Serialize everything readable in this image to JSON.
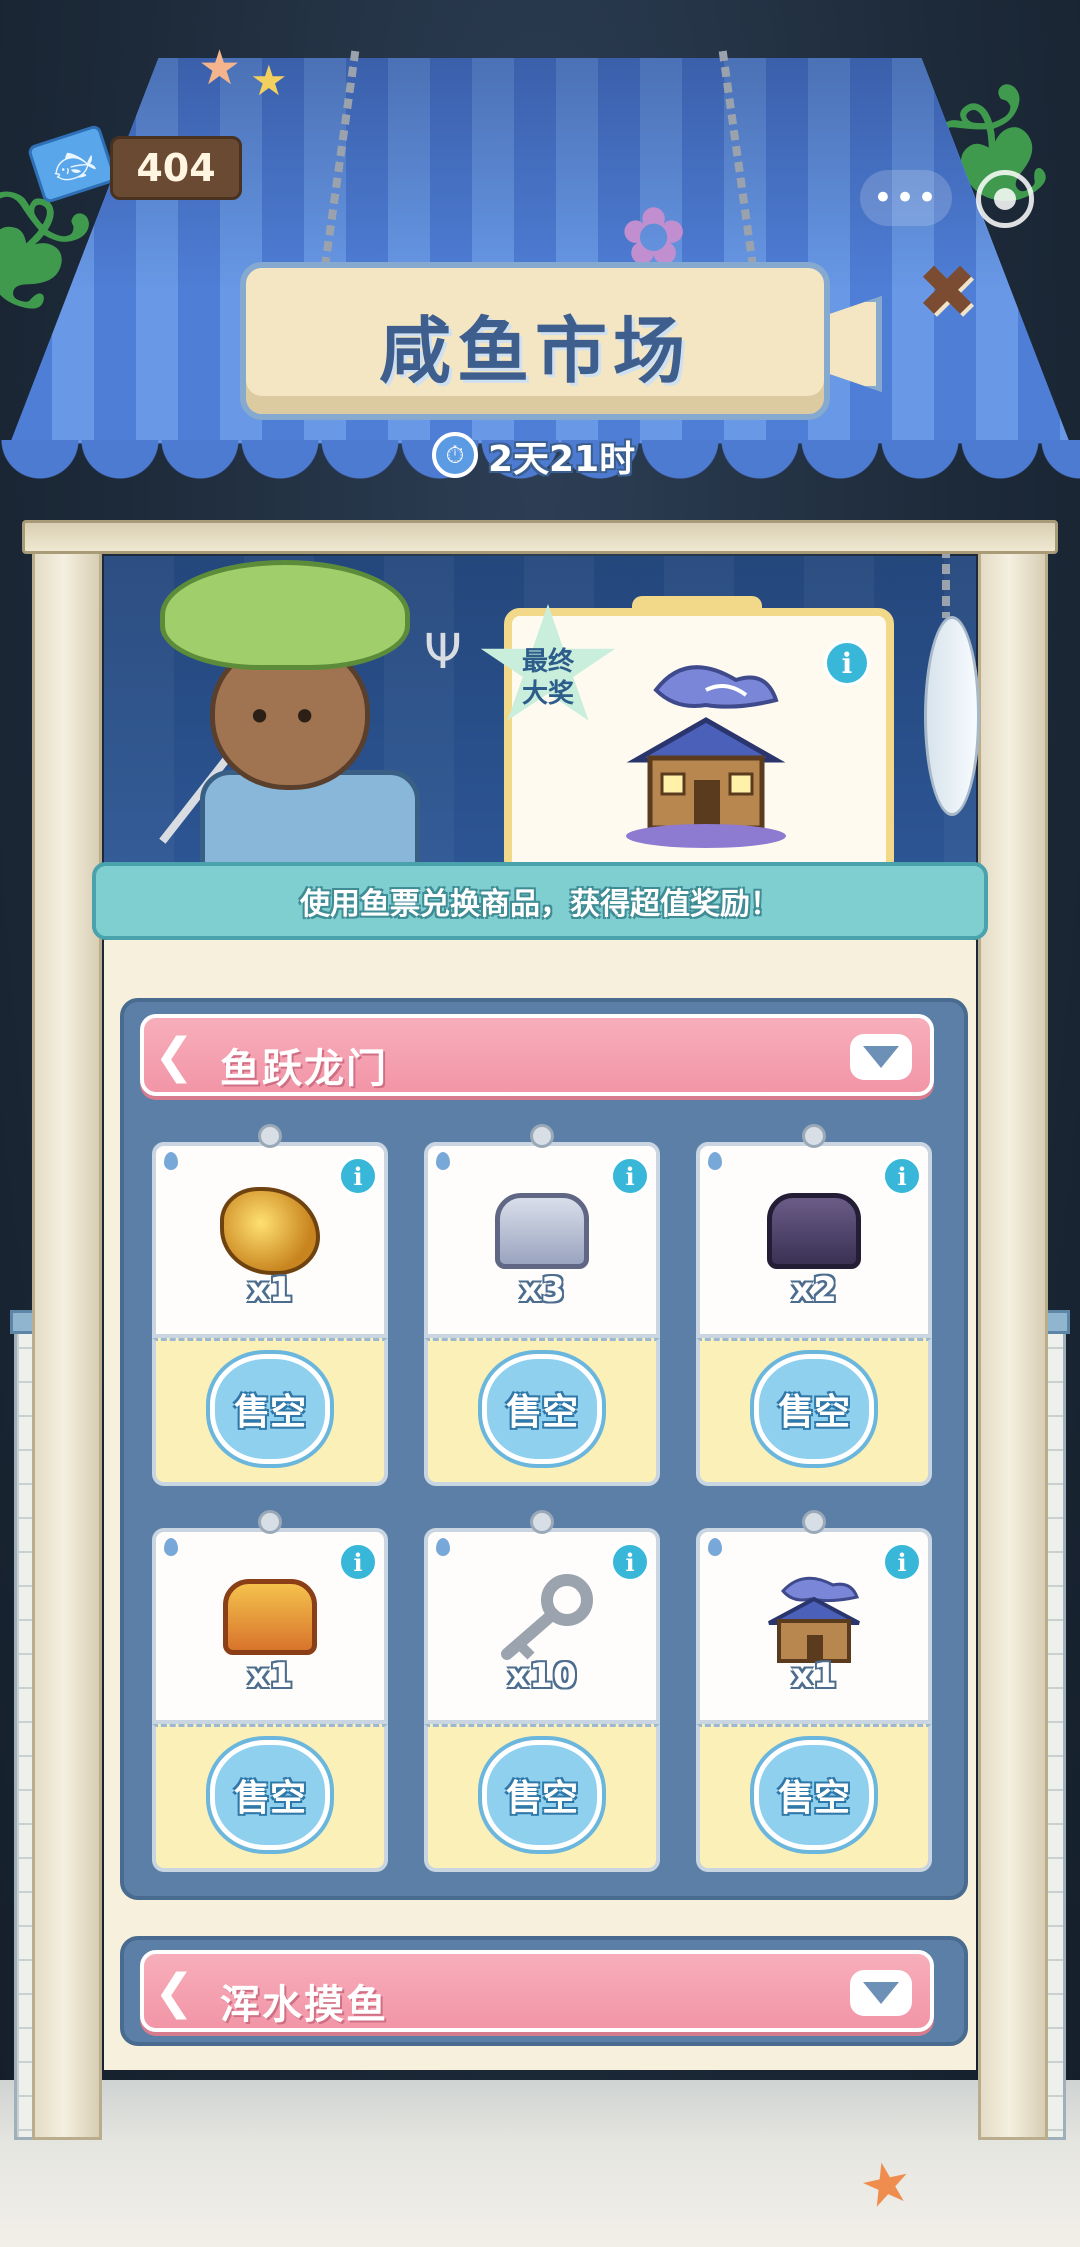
{
  "currency": {
    "icon": "fish-ticket-icon",
    "amount": "404"
  },
  "top_controls": {
    "more_label": "•••",
    "close_label": "✖"
  },
  "sign": {
    "title": "咸鱼市场",
    "timer_icon": "stopwatch-icon",
    "timer": "2天21时"
  },
  "hero": {
    "badge": "最终\n大奖",
    "badge_line1": "最终",
    "badge_line2": "大奖",
    "info_label": "i",
    "ribbon_text": "使用鱼票兑换商品，获得超值奖励！"
  },
  "sections": [
    {
      "title": "鱼跃龙门",
      "items": [
        {
          "icon": "golden-dragon-icon",
          "qty": "x1",
          "status": "售空",
          "info": "i"
        },
        {
          "icon": "silver-chest-icon",
          "qty": "x3",
          "status": "售空",
          "info": "i"
        },
        {
          "icon": "dark-chest-icon",
          "qty": "x2",
          "status": "售空",
          "info": "i"
        },
        {
          "icon": "golden-winged-chest-icon",
          "qty": "x1",
          "status": "售空",
          "info": "i"
        },
        {
          "icon": "silver-key-icon",
          "qty": "x10",
          "status": "售空",
          "info": "i"
        },
        {
          "icon": "shark-house-icon",
          "qty": "x1",
          "status": "售空",
          "info": "i"
        }
      ]
    },
    {
      "title": "浑水摸鱼"
    }
  ],
  "colors": {
    "roof_blue": "#4f7ed6",
    "section_pink": "#f295a7",
    "panel_blue": "#5b7fa6",
    "sold_badge": "#8fd0ef",
    "ribbon_teal": "#7fcfd1"
  }
}
